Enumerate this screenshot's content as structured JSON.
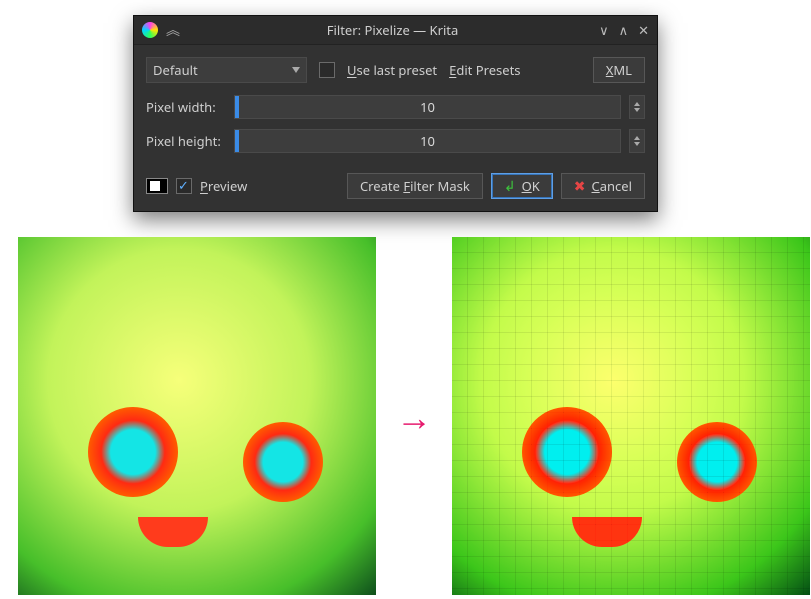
{
  "window": {
    "title": "Filter: Pixelize — Krita"
  },
  "toolbar": {
    "preset_combo": "Default",
    "use_last_preset_label": "Use last preset",
    "edit_presets_label": "Edit Presets",
    "xml_label": "XML"
  },
  "sliders": {
    "pixel_width": {
      "label": "Pixel width:",
      "value": "10"
    },
    "pixel_height": {
      "label": "Pixel height:",
      "value": "10"
    }
  },
  "footer": {
    "preview_label": "Preview",
    "preview_checked": true,
    "create_mask_label": "Create Filter Mask",
    "ok_label": "OK",
    "cancel_label": "Cancel"
  },
  "arrow_glyph": "→"
}
